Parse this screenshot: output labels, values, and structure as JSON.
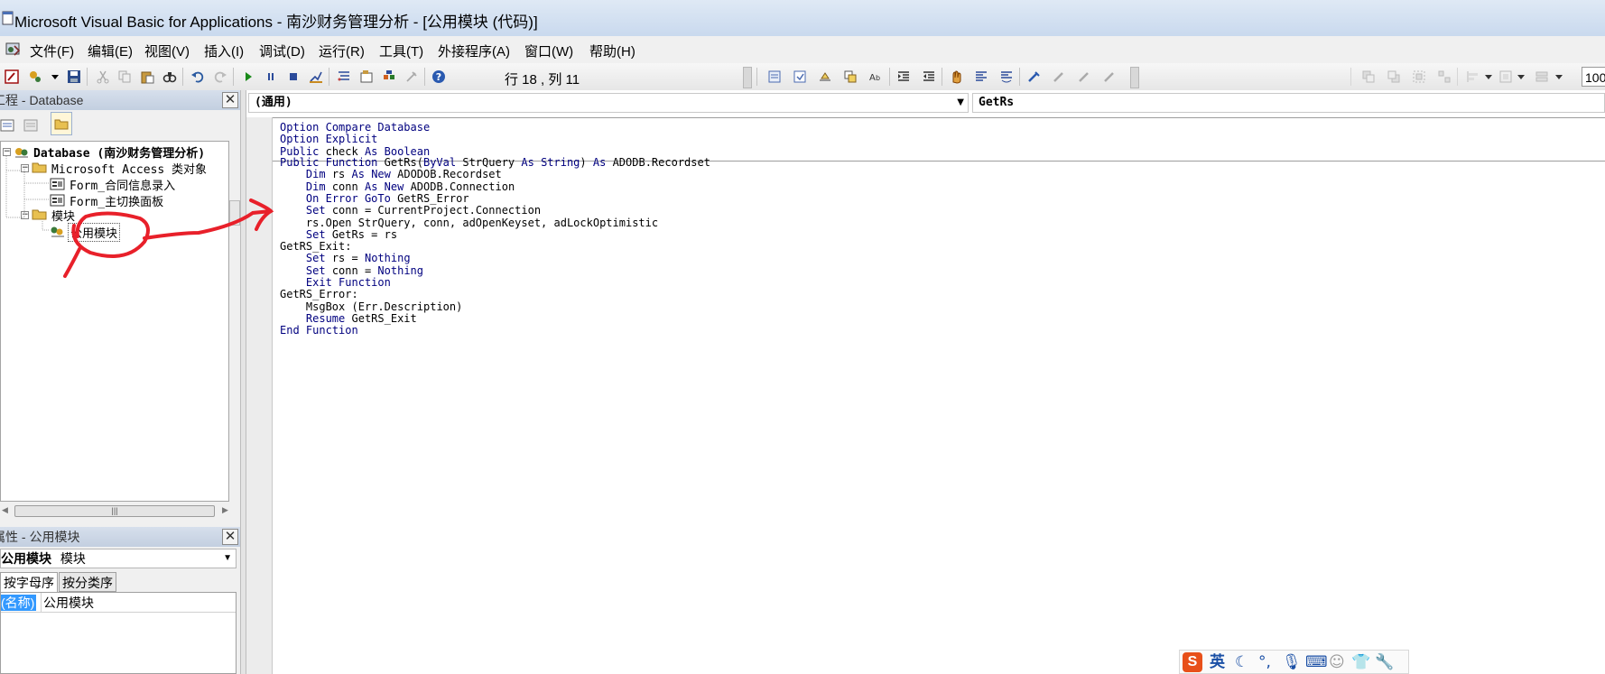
{
  "window": {
    "title": "Microsoft Visual Basic for Applications - 南沙财务管理分析 - [公用模块 (代码)]"
  },
  "menu": {
    "items": [
      {
        "label": "文件(F)"
      },
      {
        "label": "编辑(E)"
      },
      {
        "label": "视图(V)"
      },
      {
        "label": "插入(I)"
      },
      {
        "label": "调试(D)"
      },
      {
        "label": "运行(R)"
      },
      {
        "label": "工具(T)"
      },
      {
        "label": "外接程序(A)"
      },
      {
        "label": "窗口(W)"
      },
      {
        "label": "帮助(H)"
      }
    ]
  },
  "toolbar": {
    "cursor_position": "行 18 , 列 11",
    "zoom": "100"
  },
  "project_panel": {
    "title": "工程 - Database",
    "tree": {
      "root": "Database (南沙财务管理分析)",
      "access_group": "Microsoft Access 类对象",
      "forms": [
        "Form_合同信息录入",
        "Form_主切换面板"
      ],
      "modules_group": "模块",
      "modules": [
        "公用模块"
      ]
    }
  },
  "properties_panel": {
    "title": "属性 - 公用模块",
    "object_name": "公用模块",
    "object_type": "模块",
    "tabs": [
      "按字母序",
      "按分类序"
    ],
    "rows": [
      {
        "name": "(名称)",
        "value": "公用模块"
      }
    ]
  },
  "code_window": {
    "object_combo": "(通用)",
    "procedure_combo": "GetRs",
    "declarations": [
      "Option Compare Database",
      "Option Explicit",
      "Public check As Boolean"
    ],
    "procedure": [
      "Public Function GetRs(ByVal StrQuery As String) As ADODB.Recordset",
      "    Dim rs As New ADODOB.Recordset",
      "    Dim conn As New ADODB.Connection",
      "    On Error GoTo GetRS_Error",
      "    Set conn = CurrentProject.Connection",
      "    rs.Open StrQuery, conn, adOpenKeyset, adLockOptimistic",
      "    Set GetRs = rs",
      "GetRS_Exit:",
      "    Set rs = Nothing",
      "    Set conn = Nothing",
      "    Exit Function",
      "GetRS_Error:",
      "    MsgBox (Err.Description)",
      "    Resume GetRS_Exit",
      "End Function"
    ]
  },
  "ime": {
    "mode": "英"
  },
  "colors": {
    "keyword": "#00007f",
    "annotation": "#e8202a",
    "selection": "#3399ff"
  }
}
